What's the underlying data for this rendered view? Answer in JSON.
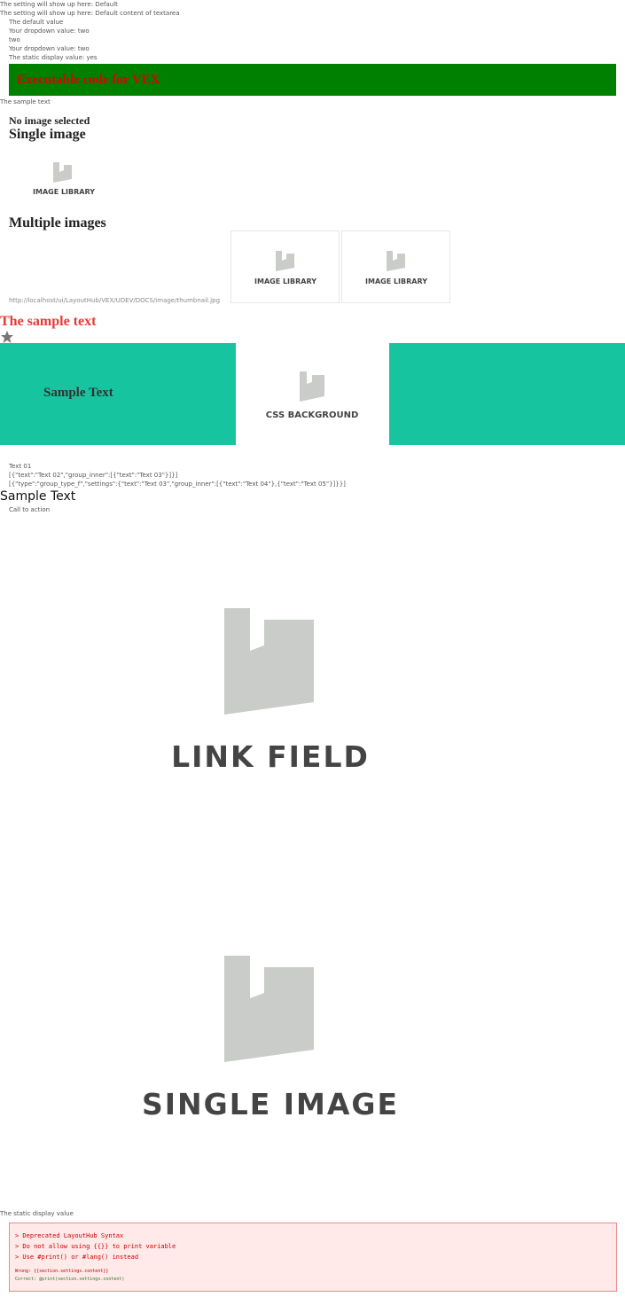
{
  "settings": {
    "line1": "The setting will show up here: Default",
    "line2": "The setting will show up here: Default content of textarea",
    "default_value": "The default value",
    "dropdown1": "Your dropdown value: two",
    "two": "two",
    "dropdown2": "Your dropdown value: two",
    "static_display": "The static display value: yes"
  },
  "banner": {
    "text": "Executable code for VEX"
  },
  "sample_text_small": "The sample text",
  "no_image": "No image selected",
  "single_image_heading": "Single image",
  "image_library_caption": "IMAGE LIBRARY",
  "multiple_images_heading": "Multiple images",
  "thumbnail_url": "http://localhost/ui/LayoutHub/VEX/UDEV/DOCS/image/thumbnail.jpg",
  "red_heading": "The sample text",
  "teal_section": {
    "text": "Sample Text",
    "css_caption": "CSS BACKGROUND"
  },
  "text_lines": {
    "t1": "Text 01",
    "t2": "[{\"text\":\"Text 02\",\"group_inner\":[{\"text\":\"Text 03\"}]}]",
    "t3": "[{\"type\":\"group_type_f\",\"settings\":{\"text\":\"Text 03\",\"group_inner\":[{\"text\":\"Text 04\"},{\"text\":\"Text 05\"}]}}]"
  },
  "sample_text_large": "Sample Text",
  "call_to_action": "Call to action",
  "link_field_caption": "LINK FIELD",
  "single_image_caption": "SINGLE IMAGE",
  "static_display_plain": "The static display value",
  "error": {
    "l1": "> Deprecated LayoutHub Syntax",
    "l2": "> Do not allow using {{}} to print variable",
    "l3": "> Use #print() or #lang() instead",
    "l4": "Wrong: {{section.settings.content}}",
    "l5": "Correct: @print(section.settings.content)"
  },
  "colors": {
    "banner": "#008000",
    "teal": "#16c59f",
    "red": "#e53935"
  }
}
